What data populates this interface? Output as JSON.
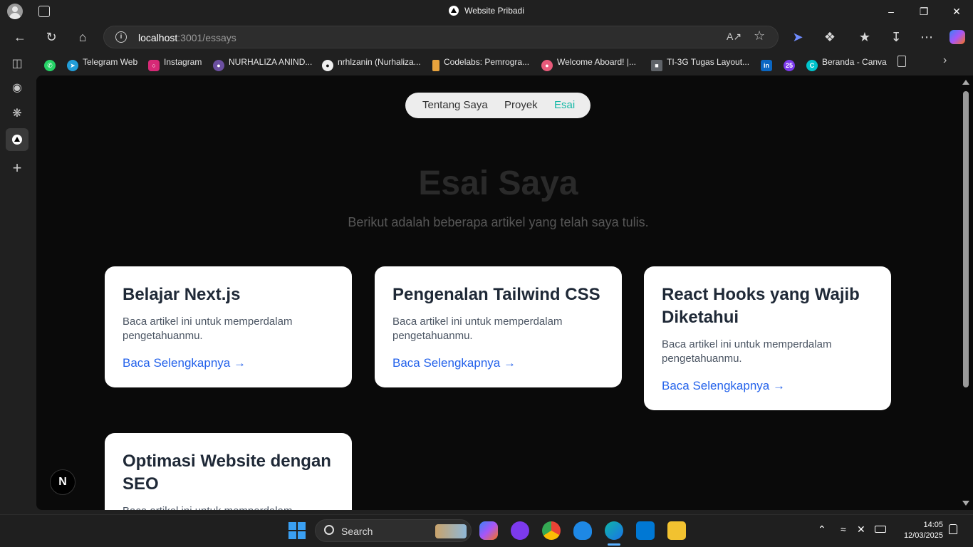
{
  "window": {
    "title": "Website Pribadi"
  },
  "browser": {
    "url_host": "localhost",
    "url_rest": ":3001/essays"
  },
  "favorites": [
    {
      "label": "Telegram Web",
      "icon": "telegram-icon",
      "color": "#229ED9"
    },
    {
      "label": "Instagram",
      "icon": "instagram-icon",
      "color": "#d62976"
    },
    {
      "label": "NURHALIZA ANIND...",
      "icon": "university-icon",
      "color": "#6b4fa0"
    },
    {
      "label": "nrhlzanin (Nurhaliza...",
      "icon": "github-icon",
      "color": "#333333"
    },
    {
      "label": "Codelabs: Pemrogra...",
      "icon": "codelabs-icon",
      "color": "#e8a33d"
    },
    {
      "label": "Welcome Aboard! |...",
      "icon": "brain-icon",
      "color": "#e85a7a"
    },
    {
      "label": "TI-3G Tugas Layout...",
      "icon": "classroom-icon",
      "color": "#5f6368"
    },
    {
      "label": "",
      "icon": "linkedin-icon",
      "color": "#0a66c2"
    },
    {
      "label": "",
      "icon": "badge-25-icon",
      "color": "#7c3aed"
    },
    {
      "label": "Beranda - Canva",
      "icon": "canva-icon",
      "color": "#00c4cc"
    }
  ],
  "page": {
    "nav": [
      "Tentang Saya",
      "Proyek",
      "Esai"
    ],
    "heading": "Esai Saya",
    "subheading": "Berikut adalah beberapa artikel yang telah saya tulis.",
    "cards": [
      {
        "title": "Belajar Next.js",
        "desc": "Baca artikel ini untuk memperdalam pengetahuanmu.",
        "link": "Baca Selengkapnya →"
      },
      {
        "title": "Pengenalan Tailwind CSS",
        "desc": "Baca artikel ini untuk memperdalam pengetahuanmu.",
        "link": "Baca Selengkapnya →"
      },
      {
        "title": "React Hooks yang Wajib Diketahui",
        "desc": "Baca artikel ini untuk memperdalam pengetahuanmu.",
        "link": "Baca Selengkapnya →"
      },
      {
        "title": "Optimasi Website dengan SEO",
        "desc": "Baca artikel ini untuk memperdalam",
        "link": ""
      }
    ],
    "next_badge": "N"
  },
  "taskbar": {
    "search_label": "Search",
    "time": "14:05",
    "date": "12/03/2025"
  },
  "colors": {
    "accent_active_nav": "#14b8a6",
    "link": "#2563eb"
  }
}
